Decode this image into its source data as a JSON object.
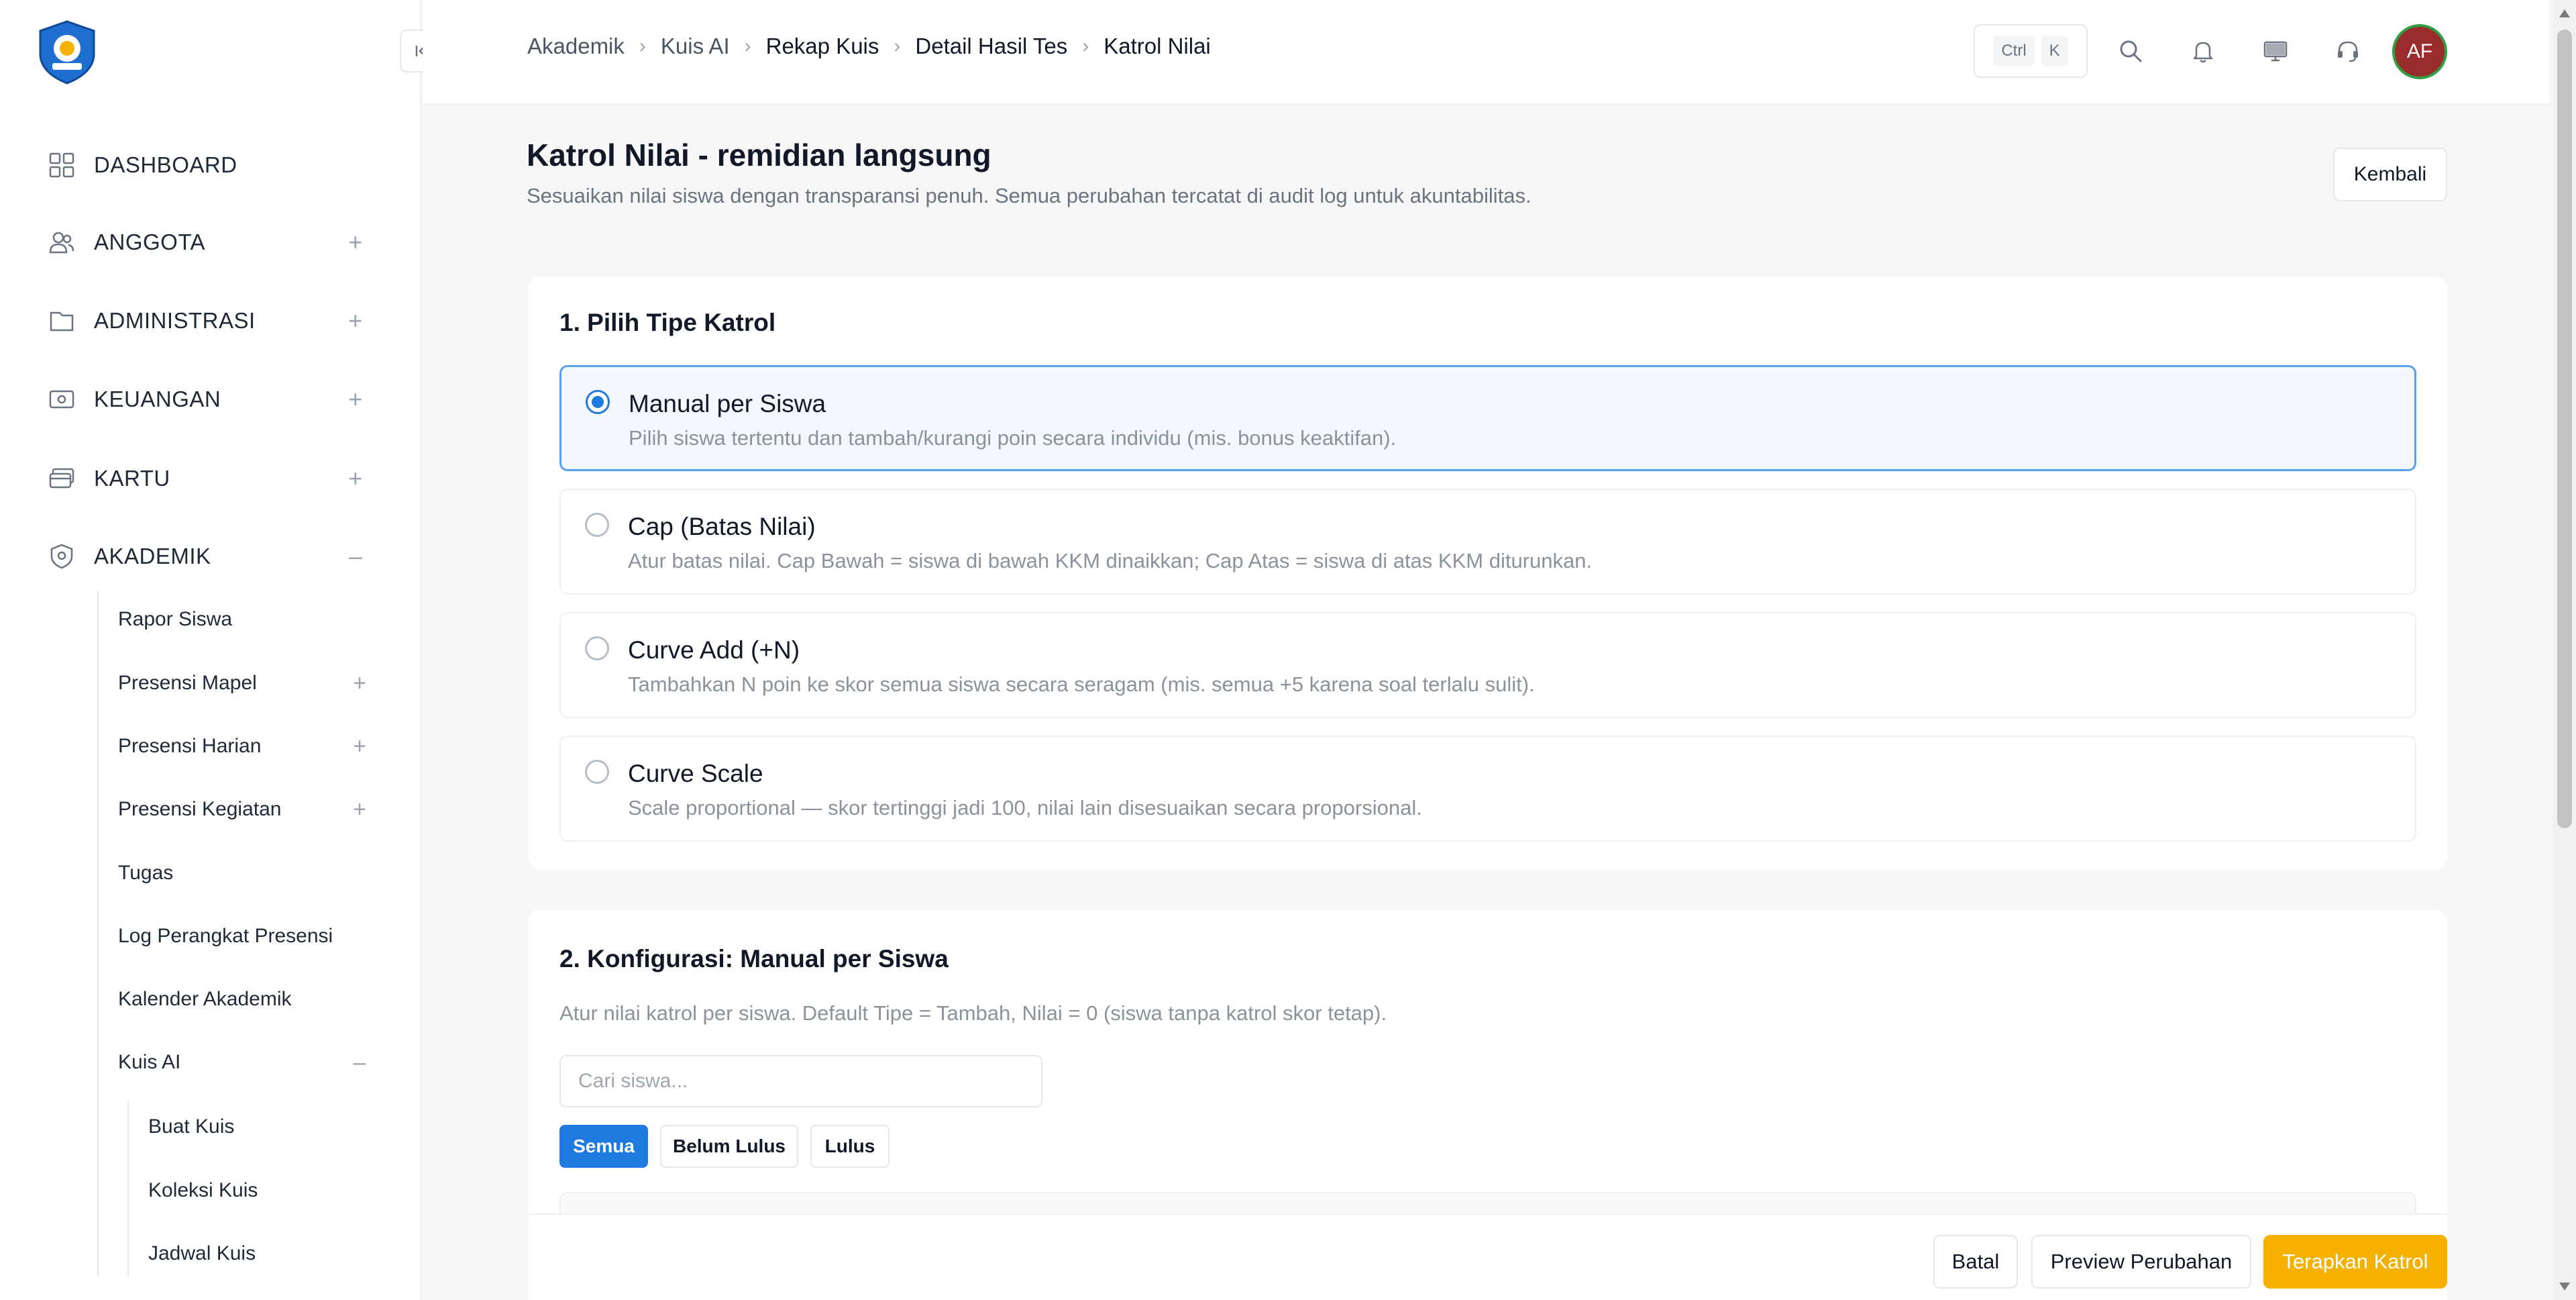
{
  "sidebar": {
    "menu": [
      {
        "label": "DASHBOARD",
        "icon": "grid-icon",
        "expander": ""
      },
      {
        "label": "ANGGOTA",
        "icon": "users-icon",
        "expander": "+"
      },
      {
        "label": "ADMINISTRASI",
        "icon": "folder-icon",
        "expander": "+"
      },
      {
        "label": "KEUANGAN",
        "icon": "cash-icon",
        "expander": "+"
      },
      {
        "label": "KARTU",
        "icon": "card-icon",
        "expander": "+"
      },
      {
        "label": "AKADEMIK",
        "icon": "shield-icon",
        "expander": "–"
      }
    ],
    "akademik_items": [
      {
        "label": "Rapor Siswa",
        "expander": ""
      },
      {
        "label": "Presensi Mapel",
        "expander": "+"
      },
      {
        "label": "Presensi Harian",
        "expander": "+"
      },
      {
        "label": "Presensi Kegiatan",
        "expander": "+"
      },
      {
        "label": "Tugas",
        "expander": ""
      },
      {
        "label": "Log Perangkat Presensi",
        "expander": ""
      },
      {
        "label": "Kalender Akademik",
        "expander": ""
      },
      {
        "label": "Kuis AI",
        "expander": "–"
      }
    ],
    "kuis_items": [
      "Buat Kuis",
      "Koleksi Kuis",
      "Jadwal Kuis"
    ]
  },
  "header": {
    "breadcrumb": [
      "Akademik",
      "Kuis AI",
      "Rekap Kuis",
      "Detail Hasil Tes",
      "Katrol Nilai"
    ],
    "shortcut": [
      "Ctrl",
      "K"
    ],
    "avatar_initials": "AF"
  },
  "page": {
    "title": "Katrol Nilai - remidian langsung",
    "subtitle": "Sesuaikan nilai siswa dengan transparansi penuh. Semua perubahan tercatat di audit log untuk akuntabilitas.",
    "back_label": "Kembali"
  },
  "section1": {
    "title": "1. Pilih Tipe Katrol",
    "options": [
      {
        "title": "Manual per Siswa",
        "desc": "Pilih siswa tertentu dan tambah/kurangi poin secara individu (mis. bonus keaktifan).",
        "selected": true
      },
      {
        "title": "Cap (Batas Nilai)",
        "desc": "Atur batas nilai. Cap Bawah = siswa di bawah KKM dinaikkan; Cap Atas = siswa di atas KKM diturunkan.",
        "selected": false
      },
      {
        "title": "Curve Add (+N)",
        "desc": "Tambahkan N poin ke skor semua siswa secara seragam (mis. semua +5 karena soal terlalu sulit).",
        "selected": false
      },
      {
        "title": "Curve Scale",
        "desc": "Scale proportional — skor tertinggi jadi 100, nilai lain disesuaikan secara proporsional.",
        "selected": false
      }
    ]
  },
  "section2": {
    "title": "2. Konfigurasi: Manual per Siswa",
    "desc": "Atur nilai katrol per siswa. Default Tipe = Tambah, Nilai = 0 (siswa tanpa katrol skor tetap).",
    "search_placeholder": "Cari siswa...",
    "filters": [
      {
        "label": "Semua",
        "active": true
      },
      {
        "label": "Belum Lulus",
        "active": false
      },
      {
        "label": "Lulus",
        "active": false
      }
    ]
  },
  "footer": {
    "cancel_label": "Batal",
    "preview_label": "Preview Perubahan",
    "apply_label": "Terapkan Katrol"
  },
  "colors": {
    "accent": "#1f7ae0",
    "apply": "#f5b000",
    "avatar_bg": "#9b2c2c",
    "avatar_ring": "#2f9e44"
  }
}
